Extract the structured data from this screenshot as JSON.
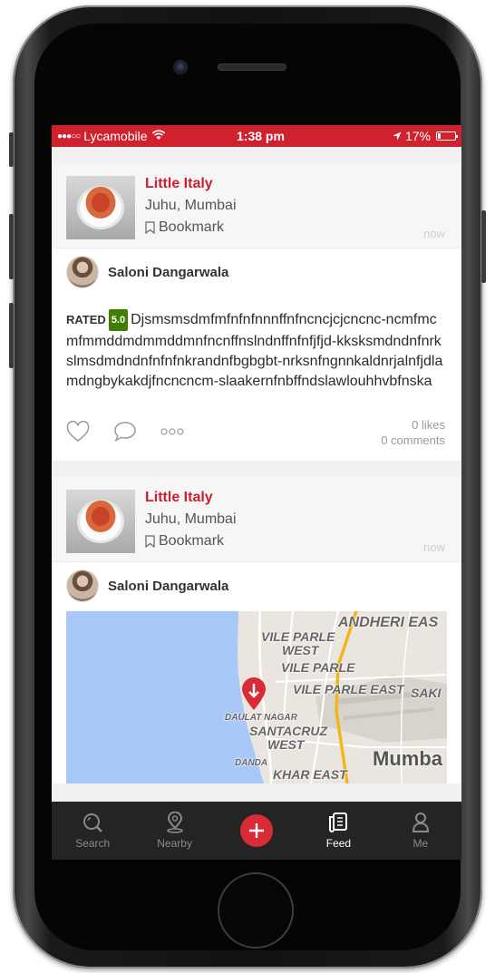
{
  "status_bar": {
    "signal": "●●●○○",
    "carrier": "Lycamobile",
    "wifi_icon": "wifi-icon",
    "time": "1:38 pm",
    "location_icon": "location-arrow-icon",
    "battery_percent": "17%",
    "battery_level": 0.17,
    "accent_color": "#d0212f"
  },
  "feed": {
    "posts": [
      {
        "restaurant": {
          "name": "Little Italy",
          "location": "Juhu, Mumbai",
          "bookmark_label": "Bookmark",
          "timestamp": "now"
        },
        "user": {
          "name": "Saloni Dangarwala"
        },
        "review": {
          "rated_label": "RATED",
          "rating": "5.0",
          "text": "Djsmsmsdmfmfnfnfnnnffnfncncjcjcncnc-ncmfmcmfmmddmdmmddmnfncnffnslndnffnfnfjfjd-kksksmdndnfnrkslmsdmdndnfnfnfnkrandnfbgbgbt-nrksnfngnnkaldnrjalnfjdlamdngbykakdjfncncncm-slaakernfnbffndslawlouhhvbfnska"
        },
        "likes": "0 likes",
        "comments": "0 comments"
      },
      {
        "restaurant": {
          "name": "Little Italy",
          "location": "Juhu, Mumbai",
          "bookmark_label": "Bookmark",
          "timestamp": "now"
        },
        "user": {
          "name": "Saloni Dangarwala"
        },
        "map": {
          "labels": {
            "andheri": "ANDHERI EAS",
            "vile_parle_west_1": "VILE PARLE",
            "vile_parle_west_2": "WEST",
            "vile_parle": "VILE PARLE",
            "vile_parle_east": "VILE PARLE EAST",
            "saki": "SAKI",
            "daulat_nagar": "DAULAT NAGAR",
            "santacruz_1": "SANTACRUZ",
            "santacruz_2": "WEST",
            "mumbai": "Mumba",
            "danda": "DANDA",
            "khar_east": "KHAR EAST"
          }
        }
      }
    ]
  },
  "tab_bar": {
    "tabs": [
      {
        "label": "Search",
        "icon": "search-icon"
      },
      {
        "label": "Nearby",
        "icon": "map-pin-icon"
      },
      {
        "label": "",
        "icon": "plus-icon"
      },
      {
        "label": "Feed",
        "icon": "feed-icon"
      },
      {
        "label": "Me",
        "icon": "user-icon"
      }
    ],
    "active": "Feed"
  }
}
